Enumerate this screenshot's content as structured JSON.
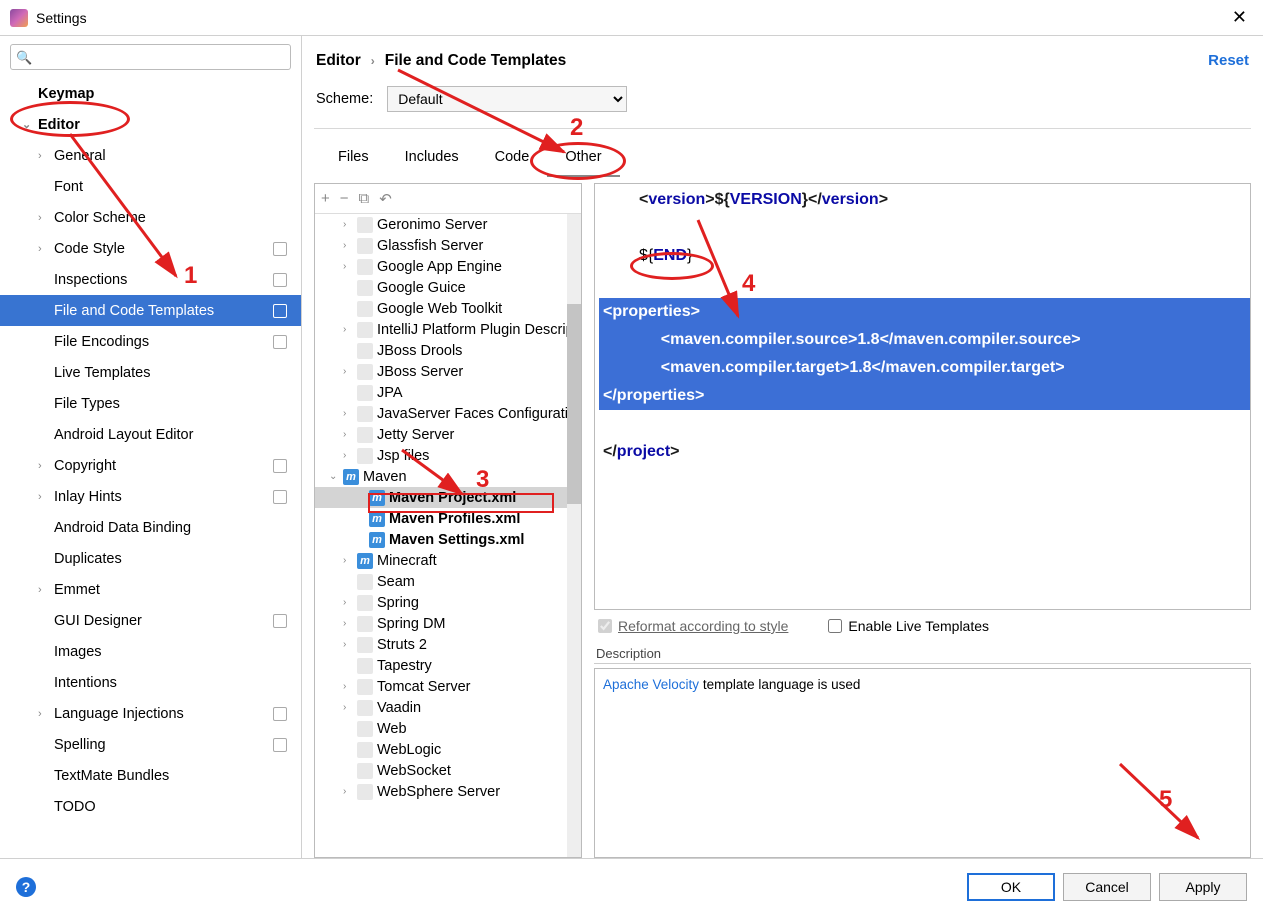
{
  "window": {
    "title": "Settings",
    "close": "✕"
  },
  "search": {
    "placeholder": ""
  },
  "sidebar": [
    {
      "label": "Keymap",
      "lvl": 0,
      "chev": ""
    },
    {
      "label": "Editor",
      "lvl": 0,
      "chev": "v"
    },
    {
      "label": "General",
      "lvl": 1,
      "chev": ">"
    },
    {
      "label": "Font",
      "lvl": 1,
      "chev": ""
    },
    {
      "label": "Color Scheme",
      "lvl": 1,
      "chev": ">"
    },
    {
      "label": "Code Style",
      "lvl": 1,
      "chev": ">",
      "badge": true
    },
    {
      "label": "Inspections",
      "lvl": 1,
      "chev": "",
      "badge": true
    },
    {
      "label": "File and Code Templates",
      "lvl": 1,
      "chev": "",
      "badge": true,
      "selected": true
    },
    {
      "label": "File Encodings",
      "lvl": 1,
      "chev": "",
      "badge": true
    },
    {
      "label": "Live Templates",
      "lvl": 1,
      "chev": ""
    },
    {
      "label": "File Types",
      "lvl": 1,
      "chev": ""
    },
    {
      "label": "Android Layout Editor",
      "lvl": 1,
      "chev": ""
    },
    {
      "label": "Copyright",
      "lvl": 1,
      "chev": ">",
      "badge": true
    },
    {
      "label": "Inlay Hints",
      "lvl": 1,
      "chev": ">",
      "badge": true
    },
    {
      "label": "Android Data Binding",
      "lvl": 1,
      "chev": ""
    },
    {
      "label": "Duplicates",
      "lvl": 1,
      "chev": ""
    },
    {
      "label": "Emmet",
      "lvl": 1,
      "chev": ">"
    },
    {
      "label": "GUI Designer",
      "lvl": 1,
      "chev": "",
      "badge": true
    },
    {
      "label": "Images",
      "lvl": 1,
      "chev": ""
    },
    {
      "label": "Intentions",
      "lvl": 1,
      "chev": ""
    },
    {
      "label": "Language Injections",
      "lvl": 1,
      "chev": ">",
      "badge": true
    },
    {
      "label": "Spelling",
      "lvl": 1,
      "chev": "",
      "badge": true
    },
    {
      "label": "TextMate Bundles",
      "lvl": 1,
      "chev": ""
    },
    {
      "label": "TODO",
      "lvl": 1,
      "chev": ""
    }
  ],
  "breadcrumb": {
    "root": "Editor",
    "page": "File and Code Templates"
  },
  "reset": "Reset",
  "scheme": {
    "label": "Scheme:",
    "value": "Default"
  },
  "tabs": [
    "Files",
    "Includes",
    "Code",
    "Other"
  ],
  "active_tab": 3,
  "toolbar": {
    "add": "+",
    "remove": "−",
    "copy": "⧉",
    "undo": "↶"
  },
  "templates": [
    {
      "chev": ">",
      "icon": "g",
      "label": "Geronimo Server"
    },
    {
      "chev": ">",
      "icon": "g",
      "label": "Glassfish Server"
    },
    {
      "chev": ">",
      "icon": "g",
      "label": "Google App Engine"
    },
    {
      "chev": "",
      "icon": "G",
      "label": "Google Guice"
    },
    {
      "chev": "",
      "icon": "g",
      "label": "Google Web Toolkit"
    },
    {
      "chev": ">",
      "icon": "i",
      "label": "IntelliJ Platform Plugin Descrip"
    },
    {
      "chev": "",
      "icon": "d",
      "label": "JBoss Drools"
    },
    {
      "chev": ">",
      "icon": "j",
      "label": "JBoss Server"
    },
    {
      "chev": "",
      "icon": "j",
      "label": "JPA"
    },
    {
      "chev": ">",
      "icon": "j",
      "label": "JavaServer Faces Configuratio"
    },
    {
      "chev": ">",
      "icon": "j",
      "label": "Jetty Server"
    },
    {
      "chev": ">",
      "icon": "j",
      "label": "Jsp files"
    },
    {
      "chev": "v",
      "icon": "m",
      "label": "Maven",
      "expanded": true
    },
    {
      "lvl": 2,
      "icon": "m",
      "label": "Maven Project.xml",
      "sel": true
    },
    {
      "lvl": 2,
      "icon": "m",
      "label": "Maven Profiles.xml"
    },
    {
      "lvl": 2,
      "icon": "m",
      "label": "Maven Settings.xml"
    },
    {
      "chev": ">",
      "icon": "m",
      "label": "Minecraft"
    },
    {
      "chev": "",
      "icon": "s",
      "label": "Seam"
    },
    {
      "chev": ">",
      "icon": "s",
      "label": "Spring"
    },
    {
      "chev": ">",
      "icon": "s",
      "label": "Spring DM"
    },
    {
      "chev": ">",
      "icon": "s",
      "label": "Struts 2"
    },
    {
      "chev": "",
      "icon": "t",
      "label": "Tapestry"
    },
    {
      "chev": ">",
      "icon": "t",
      "label": "Tomcat Server"
    },
    {
      "chev": ">",
      "icon": "v",
      "label": "Vaadin"
    },
    {
      "chev": "",
      "icon": "w",
      "label": "Web"
    },
    {
      "chev": "",
      "icon": "w",
      "label": "WebLogic"
    },
    {
      "chev": "",
      "icon": "w",
      "label": "WebSocket"
    },
    {
      "chev": ">",
      "icon": "w",
      "label": "WebSphere Server"
    }
  ],
  "code": {
    "l1_pre": "<",
    "l1_tag": "version",
    "l1_mid": ">${",
    "l1_var": "VERSION",
    "l1_end": "}</",
    "l1_tag2": "version",
    "l1_close": ">",
    "l3_pre": "${",
    "l3_var": "END",
    "l3_end": "}",
    "l5": "<properties>",
    "l6": "    <maven.compiler.source>1.8</maven.compiler.source>",
    "l7": "    <maven.compiler.target>1.8</maven.compiler.target>",
    "l8": "</properties>",
    "l10_pre": "</",
    "l10_tag": "project",
    "l10_close": ">"
  },
  "opts": {
    "reformat": "Reformat according to style",
    "live": "Enable Live Templates"
  },
  "desc": {
    "label": "Description",
    "link": "Apache Velocity",
    "rest": " template language is used"
  },
  "footer": {
    "ok": "OK",
    "cancel": "Cancel",
    "apply": "Apply"
  },
  "ann": {
    "n1": "1",
    "n2": "2",
    "n3": "3",
    "n4": "4",
    "n5": "5"
  }
}
